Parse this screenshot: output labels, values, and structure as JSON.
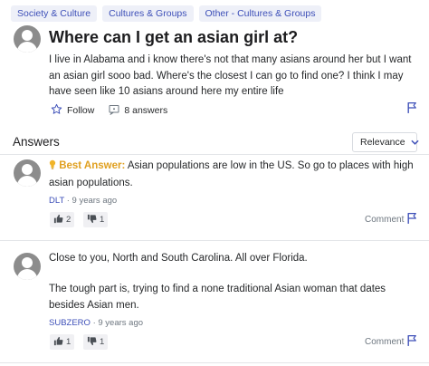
{
  "tags": [
    "Society & Culture",
    "Cultures & Groups",
    "Other - Cultures & Groups"
  ],
  "question": {
    "title": "Where can I get an asian girl at?",
    "body": "I live in Alabama and i know there's not that many asians around her but I want an asian girl sooo bad. Where's the closest I can go to find one? I think I may have seen like 10 asians around here my entire life",
    "follow_label": "Follow",
    "answers_count_label": "8 answers"
  },
  "answers_header": "Answers",
  "sort": {
    "selected": "Relevance"
  },
  "answers": [
    {
      "best_label": "Best Answer:",
      "text": "Asian populations are low in the US. So go to places with high asian populations.",
      "user": "DLT",
      "age": "· 9 years ago",
      "upvotes": "2",
      "downvotes": "1",
      "comment_label": "Comment"
    },
    {
      "text_p1": "Close to you, North and South Carolina. All over Florida.",
      "text_p2": "The tough part is, trying to find a none traditional Asian woman that dates besides Asian men.",
      "user": "SUBZERO",
      "age": "· 9 years ago",
      "upvotes": "1",
      "downvotes": "1",
      "comment_label": "Comment"
    }
  ],
  "colors": {
    "accent": "#3d4fb8",
    "best_answer": "#e0a020",
    "tag_bg": "#eef0f8"
  },
  "icons": [
    "avatar",
    "star-icon",
    "answer-count-icon",
    "flag-icon",
    "chevron-down-icon",
    "lightbulb-icon",
    "thumbs-up-icon",
    "thumbs-down-icon"
  ]
}
